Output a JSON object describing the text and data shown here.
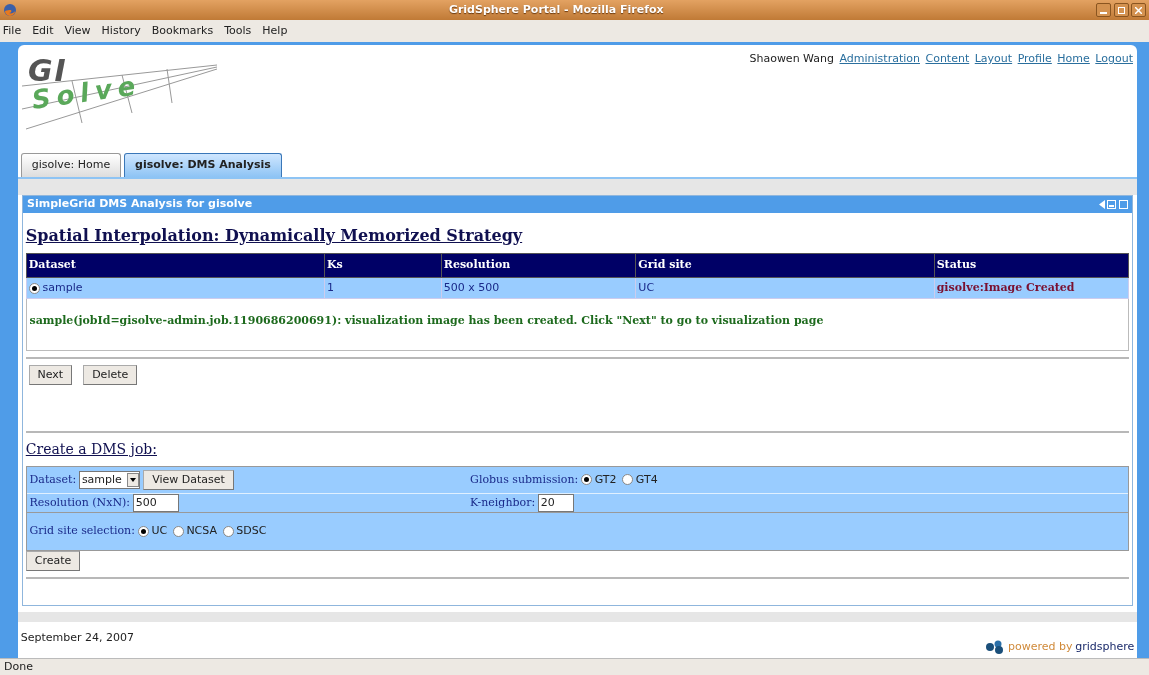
{
  "window": {
    "title": "GridSphere Portal - Mozilla Firefox"
  },
  "menu": [
    "File",
    "Edit",
    "View",
    "History",
    "Bookmarks",
    "Tools",
    "Help"
  ],
  "logo": {
    "top": "GI",
    "bottom": "Solve"
  },
  "header": {
    "user": "Shaowen Wang",
    "links": [
      "Administration",
      "Content",
      "Layout",
      "Profile",
      "Home",
      "Logout"
    ]
  },
  "tabs": [
    {
      "label": "gisolve: Home",
      "selected": false
    },
    {
      "label": "gisolve: DMS Analysis",
      "selected": true
    }
  ],
  "portlet": {
    "title": "SimpleGrid DMS Analysis for gisolve",
    "heading": "Spatial Interpolation: Dynamically Memorized Strategy",
    "table": {
      "columns": [
        "Dataset",
        "Ks",
        "Resolution",
        "Grid site",
        "Status"
      ],
      "rows": [
        {
          "selected": true,
          "cells": [
            "sample",
            "1",
            "500 x 500",
            "UC"
          ],
          "status": "gisolve:Image Created"
        }
      ]
    },
    "message": "sample(jobId=gisolve-admin.job.1190686200691): visualization image has been created. Click \"Next\" to go to visualization page",
    "buttons": [
      "Next",
      "Delete"
    ],
    "create": {
      "heading": "Create a DMS job:",
      "dataset": {
        "label": "Dataset:",
        "value": "sample",
        "button": "View Dataset"
      },
      "globus": {
        "label": "Globus submission:",
        "options": [
          {
            "label": "GT2",
            "selected": true
          },
          {
            "label": "GT4",
            "selected": false
          }
        ]
      },
      "resolution": {
        "label": "Resolution (NxN):",
        "value": "500"
      },
      "kneighbor": {
        "label": "K-neighbor:",
        "value": "20"
      },
      "gridsite": {
        "label": "Grid site selection:",
        "options": [
          {
            "label": "UC",
            "selected": true
          },
          {
            "label": "NCSA",
            "selected": false
          },
          {
            "label": "SDSC",
            "selected": false
          }
        ]
      },
      "button": "Create"
    }
  },
  "footer": {
    "date": "September 24, 2007",
    "powered": "powered by",
    "brand": "gridsphere"
  },
  "status_bar": "Done"
}
